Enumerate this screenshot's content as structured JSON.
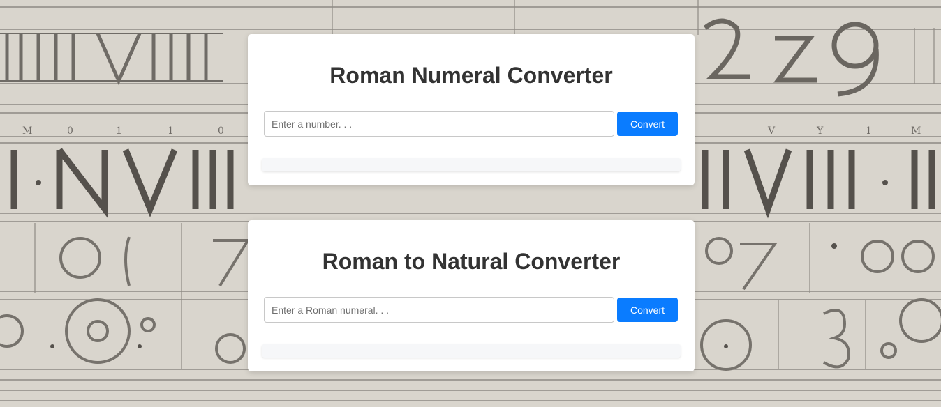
{
  "converters": [
    {
      "title": "Roman Numeral Converter",
      "input_placeholder": "Enter a number. . .",
      "input_value": "",
      "button_label": "Convert",
      "result": ""
    },
    {
      "title": "Roman to Natural Converter",
      "input_placeholder": "Enter a Roman numeral. . .",
      "input_value": "",
      "button_label": "Convert",
      "result": ""
    }
  ],
  "colors": {
    "button": "#0a7cff",
    "card": "#ffffff",
    "title": "#333333",
    "result_box": "#f6f7f9",
    "background": "#d9d5cd"
  },
  "background": {
    "image": "roman-numerals-background-illustration"
  }
}
